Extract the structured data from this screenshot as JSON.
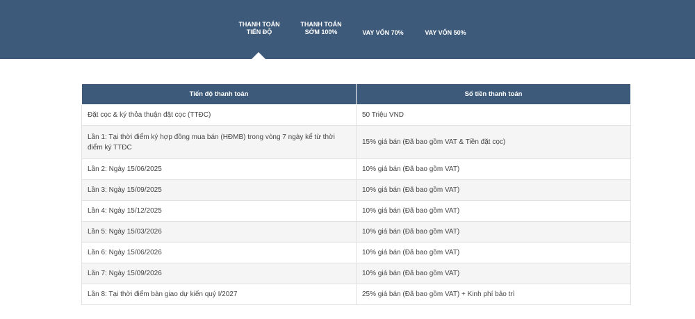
{
  "nav": {
    "tabs": [
      {
        "line1": "THANH TOÁN",
        "line2": "TIẾN ĐỘ"
      },
      {
        "line1": "THANH TOÁN",
        "line2": "SỚM 100%"
      },
      {
        "line1": "VAY VỐN 70%",
        "line2": ""
      },
      {
        "line1": "VAY VỐN 50%",
        "line2": ""
      }
    ],
    "active_index": 0
  },
  "table": {
    "headers": [
      "Tiến độ thanh toán",
      "Số tiền thanh toán"
    ],
    "rows": [
      [
        "Đặt cọc & ký thỏa thuận đặt cọc (TTĐC)",
        "50 Triệu VND"
      ],
      [
        "Lần 1: Tại thời điểm ký hợp đồng mua bán (HĐMB) trong vòng 7 ngày kể từ thời điểm ký TTĐC",
        "15% giá bán (Đã bao gồm VAT & Tiền đặt cọc)"
      ],
      [
        "Lần 2: Ngày 15/06/2025",
        "10% giá bán (Đã bao gồm VAT)"
      ],
      [
        "Lần 3: Ngày 15/09/2025",
        "10% giá bán (Đã bao gồm VAT)"
      ],
      [
        "Lần 4: Ngày 15/12/2025",
        "10% giá bán (Đã bao gồm VAT)"
      ],
      [
        "Lần 5: Ngày 15/03/2026",
        "10% giá bán (Đã bao gồm VAT)"
      ],
      [
        "Lần 6: Ngày 15/06/2026",
        "10% giá bán (Đã bao gồm VAT)"
      ],
      [
        "Lần 7: Ngày 15/09/2026",
        "10% giá bán (Đã bao gồm VAT)"
      ],
      [
        "Lần 8: Tại thời điểm bàn giao dự kiến quý I/2027",
        "25% giá bán (Đã bao gồm VAT) + Kinh phí bảo trì"
      ]
    ]
  },
  "colors": {
    "header_bg": "#3d5a7a",
    "row_alt_bg": "#f5f5f5"
  }
}
